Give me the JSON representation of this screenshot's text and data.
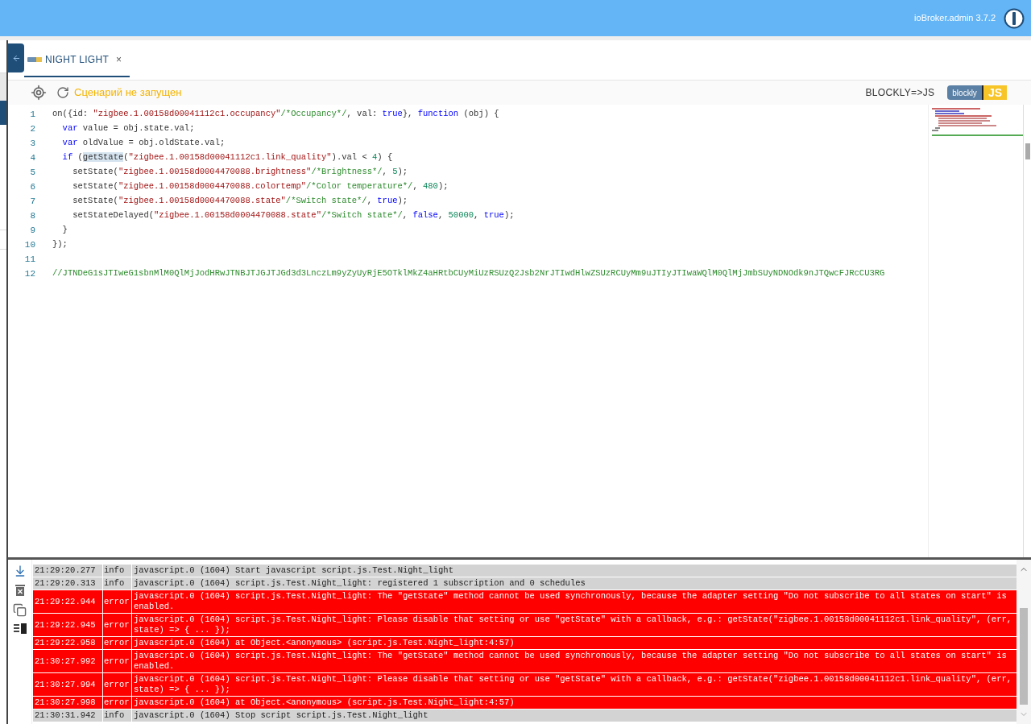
{
  "header": {
    "title": "ioBroker.admin 3.7.2"
  },
  "tabs": [
    {
      "label": "NIGHT LIGHT",
      "close": "×",
      "selected": true
    }
  ],
  "toolbar": {
    "status": "Сценарий не запущен",
    "convert_label": "BLOCKLY=>JS",
    "logo_left": "blockly",
    "logo_right": "JS"
  },
  "editor": {
    "lines": [
      {
        "number": "1",
        "tokens": [
          {
            "kind": "plain",
            "text": "on({id: "
          },
          {
            "kind": "string",
            "text": "\"zigbee.1.00158d00041112c1.occupancy\""
          },
          {
            "kind": "comment",
            "text": "/*Occupancy*/"
          },
          {
            "kind": "plain",
            "text": ", val: "
          },
          {
            "kind": "keyword",
            "text": "true"
          },
          {
            "kind": "plain",
            "text": "}, "
          },
          {
            "kind": "keyword",
            "text": "function"
          },
          {
            "kind": "plain",
            "text": " (obj) {"
          }
        ]
      },
      {
        "number": "2",
        "tokens": [
          {
            "kind": "keyword",
            "text": "  var"
          },
          {
            "kind": "plain",
            "text": " value = obj.state.val;"
          }
        ]
      },
      {
        "number": "3",
        "tokens": [
          {
            "kind": "keyword",
            "text": "  var"
          },
          {
            "kind": "plain",
            "text": " oldValue = obj.oldState.val;"
          }
        ]
      },
      {
        "number": "4",
        "tokens": [
          {
            "kind": "keyword",
            "text": "  if"
          },
          {
            "kind": "plain",
            "text": " ("
          },
          {
            "kind": "selection",
            "text": "getState"
          },
          {
            "kind": "plain",
            "text": "("
          },
          {
            "kind": "string",
            "text": "\"zigbee.1.00158d00041112c1.link_quality\""
          },
          {
            "kind": "plain",
            "text": ").val < "
          },
          {
            "kind": "number",
            "text": "4"
          },
          {
            "kind": "plain",
            "text": ") {"
          }
        ]
      },
      {
        "number": "5",
        "tokens": [
          {
            "kind": "plain",
            "text": "    setState("
          },
          {
            "kind": "string",
            "text": "\"zigbee.1.00158d0004470088.brightness\""
          },
          {
            "kind": "comment",
            "text": "/*Brightness*/"
          },
          {
            "kind": "plain",
            "text": ", "
          },
          {
            "kind": "number",
            "text": "5"
          },
          {
            "kind": "plain",
            "text": ");"
          }
        ]
      },
      {
        "number": "6",
        "tokens": [
          {
            "kind": "plain",
            "text": "    setState("
          },
          {
            "kind": "string",
            "text": "\"zigbee.1.00158d0004470088.colortemp\""
          },
          {
            "kind": "comment",
            "text": "/*Color temperature*/"
          },
          {
            "kind": "plain",
            "text": ", "
          },
          {
            "kind": "number",
            "text": "480"
          },
          {
            "kind": "plain",
            "text": ");"
          }
        ]
      },
      {
        "number": "7",
        "tokens": [
          {
            "kind": "plain",
            "text": "    setState("
          },
          {
            "kind": "string",
            "text": "\"zigbee.1.00158d0004470088.state\""
          },
          {
            "kind": "comment",
            "text": "/*Switch state*/"
          },
          {
            "kind": "plain",
            "text": ", "
          },
          {
            "kind": "keyword",
            "text": "true"
          },
          {
            "kind": "plain",
            "text": ");"
          }
        ]
      },
      {
        "number": "8",
        "tokens": [
          {
            "kind": "plain",
            "text": "    setStateDelayed("
          },
          {
            "kind": "string",
            "text": "\"zigbee.1.00158d0004470088.state\""
          },
          {
            "kind": "comment",
            "text": "/*Switch state*/"
          },
          {
            "kind": "plain",
            "text": ", "
          },
          {
            "kind": "keyword",
            "text": "false"
          },
          {
            "kind": "plain",
            "text": ", "
          },
          {
            "kind": "number",
            "text": "50000"
          },
          {
            "kind": "plain",
            "text": ", "
          },
          {
            "kind": "keyword",
            "text": "true"
          },
          {
            "kind": "plain",
            "text": ");"
          }
        ]
      },
      {
        "number": "9",
        "tokens": [
          {
            "kind": "plain",
            "text": "  }"
          }
        ]
      },
      {
        "number": "10",
        "tokens": [
          {
            "kind": "plain",
            "text": "});"
          }
        ]
      },
      {
        "number": "11"
      },
      {
        "number": "12",
        "tokens": [
          {
            "kind": "comment",
            "text": "//JTNDeG1sJTIweG1sbnMlM0QlMjJodHRwJTNBJTJGJTJGd3d3LnczLm9yZyUyRjE5OTklMkZ4aHRtbCUyMiUzRSUzQ2Jsb2NrJTIwdHlwZSUzRCUyMm9uJTIyJTIwaWQlM0QlMjJmbSUyNDNOdk9nJTQwcFJRcCU3RG"
          }
        ]
      }
    ]
  },
  "log": {
    "rows": [
      {
        "time": "21:29:20.277",
        "severity": "info",
        "message": "javascript.0 (1604) Start javascript script.js.Test.Night_light"
      },
      {
        "time": "21:29:20.313",
        "severity": "info",
        "message": "javascript.0 (1604) script.js.Test.Night_light: registered 1 subscription and 0 schedules"
      },
      {
        "time": "21:29:22.944",
        "severity": "error",
        "message": "javascript.0 (1604) script.js.Test.Night_light: The \"getState\" method cannot be used synchronously, because the adapter setting \"Do not subscribe to all states on start\" is enabled."
      },
      {
        "time": "21:29:22.945",
        "severity": "error",
        "message": "javascript.0 (1604) script.js.Test.Night_light: Please disable that setting or use \"getState\" with a callback, e.g.: getState(\"zigbee.1.00158d00041112c1.link_quality\", (err, state) => { ... });"
      },
      {
        "time": "21:29:22.958",
        "severity": "error",
        "message": "javascript.0 (1604) at Object.<anonymous> (script.js.Test.Night_light:4:57)"
      },
      {
        "time": "21:30:27.992",
        "severity": "error",
        "message": "javascript.0 (1604) script.js.Test.Night_light: The \"getState\" method cannot be used synchronously, because the adapter setting \"Do not subscribe to all states on start\" is enabled."
      },
      {
        "time": "21:30:27.994",
        "severity": "error",
        "message": "javascript.0 (1604) script.js.Test.Night_light: Please disable that setting or use \"getState\" with a callback, e.g.: getState(\"zigbee.1.00158d00041112c1.link_quality\", (err, state) => { ... });"
      },
      {
        "time": "21:30:27.998",
        "severity": "error",
        "message": "javascript.0 (1604) at Object.<anonymous> (script.js.Test.Night_light:4:57)"
      },
      {
        "time": "21:30:31.942",
        "severity": "info",
        "message": "javascript.0 (1604) Stop script script.js.Test.Night_light"
      }
    ]
  }
}
